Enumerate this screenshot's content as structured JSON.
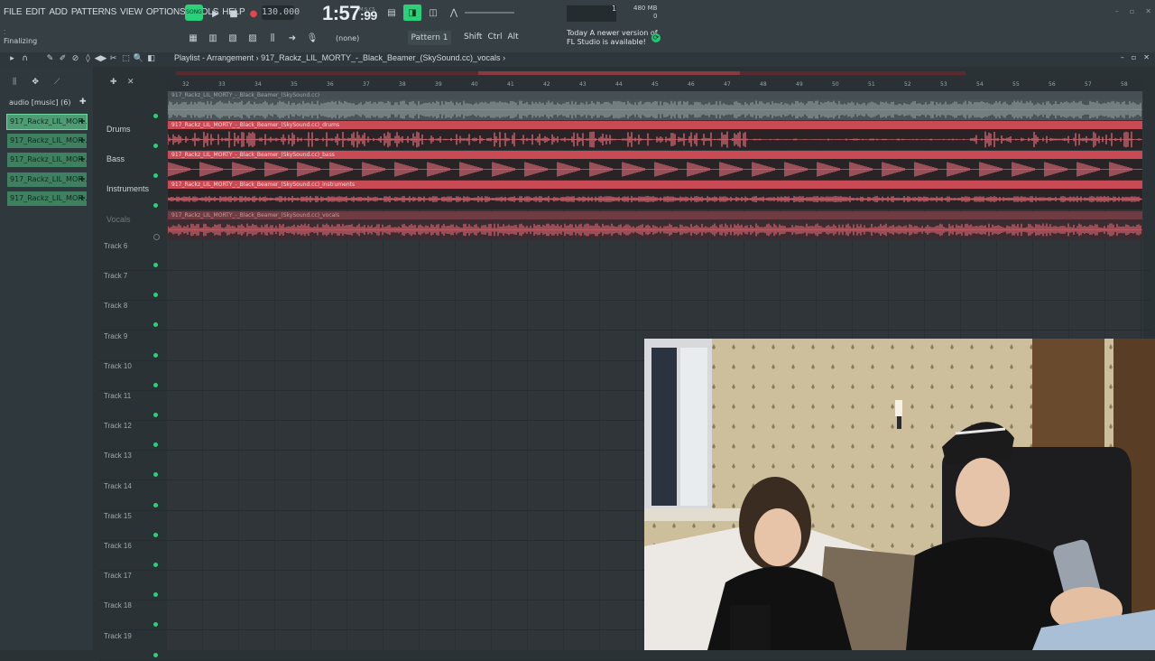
{
  "menu": [
    "FILE",
    "EDIT",
    "ADD",
    "PATTERNS",
    "VIEW",
    "OPTIONS",
    "TOOLS",
    "HELP"
  ],
  "hint": "Finalizing",
  "transport": {
    "mode_label": "SONG",
    "tempo": "130.000",
    "time_main": "1:57",
    "time_frac": "99",
    "time_unit": "M:S:CS"
  },
  "monitor": {
    "cpu_value": "1",
    "memory": "480 MB",
    "poly": "0"
  },
  "toolbar2": {
    "none_label": "(none)",
    "pattern": "Pattern 1",
    "shift": "Shift",
    "ctrl": "Ctrl",
    "alt": "Alt"
  },
  "news": {
    "line1": "Today  A newer version of",
    "line2": "FL Studio is available!"
  },
  "playlist": {
    "title": "Playlist - Arrangement",
    "breadcrumb_sep": "›",
    "current_clip": "917_Rackz_LIL_MORTY_-_Black_Beamer_(SkySound.cc)_vocals"
  },
  "browser": {
    "folder": "audio [music] (6)",
    "clips": [
      "917_Rackz_LIL_MOR...",
      "917_Rackz_LIL_MOR...",
      "917_Rackz_LIL_MOR...",
      "917_Rackz_LIL_MOR...",
      "917_Rackz_LIL_MOR..."
    ]
  },
  "tracks": [
    {
      "name": "",
      "clip": "917_Rackz_LIL_MORTY_-_Black_Beamer_(SkySound.cc)",
      "style": "dark"
    },
    {
      "name": "Drums",
      "clip": "917_Rackz_LIL_MORTY_-_Black_Beamer_(SkySound.cc)_drums",
      "style": "red"
    },
    {
      "name": "Bass",
      "clip": "917_Rackz_LIL_MORTY_-_Black_Beamer_(SkySound.cc)_bass",
      "style": "red"
    },
    {
      "name": "Instruments",
      "clip": "917_Rackz_LIL_MORTY_-_Black_Beamer_(SkySound.cc)_instruments",
      "style": "red"
    },
    {
      "name": "Vocals",
      "clip": "917_Rackz_LIL_MORTY_-_Black_Beamer_(SkySound.cc)_vocals",
      "style": "muted"
    }
  ],
  "empty_tracks": [
    "Track 6",
    "Track 7",
    "Track 8",
    "Track 9",
    "Track 10",
    "Track 11",
    "Track 12",
    "Track 13",
    "Track 14",
    "Track 15",
    "Track 16",
    "Track 17",
    "Track 18",
    "Track 19"
  ],
  "ruler": [
    "32",
    "33",
    "34",
    "35",
    "36",
    "37",
    "38",
    "39",
    "40",
    "41",
    "42",
    "43",
    "44",
    "45",
    "46",
    "47",
    "48",
    "49",
    "50",
    "51",
    "52",
    "53",
    "54",
    "55",
    "56",
    "57",
    "58"
  ],
  "colors": {
    "accent": "#2ad07a",
    "clip_red": "#c74a55",
    "clip_muted": "#6e3c42",
    "bg": "#2f3539"
  }
}
